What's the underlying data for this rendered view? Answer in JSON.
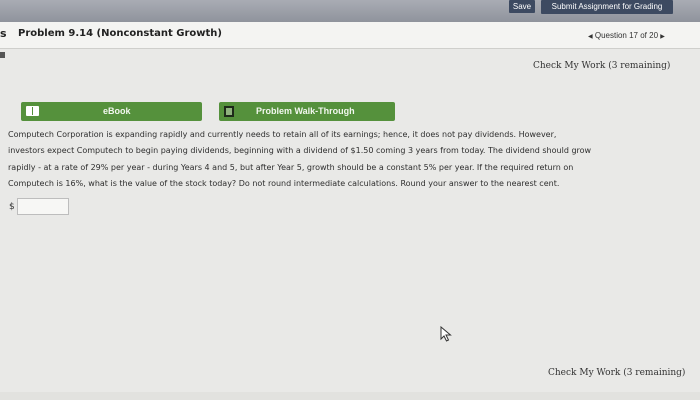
{
  "toolbar": {
    "save_label": "Save",
    "submit_label": "Submit Assignment for Grading"
  },
  "header": {
    "marker": "s",
    "problem_title": "Problem 9.14 (Nonconstant Growth)",
    "question_prev": "◀",
    "question_label": "Question 17 of 20",
    "question_next": "▶"
  },
  "check_work": {
    "top_label": "Check My Work (3 remaining)",
    "bottom_label": "Check My Work (3 remaining)"
  },
  "tools": {
    "ebook_label": "eBook",
    "walkthrough_label": "Problem Walk-Through"
  },
  "problem": {
    "lines": [
      "Computech Corporation is expanding rapidly and currently needs to retain all of its earnings; hence, it does not pay dividends. However,",
      "investors expect Computech to begin paying dividends, beginning with a dividend of $1.50 coming 3 years from today. The dividend should grow",
      "rapidly - at a rate of 29% per year - during Years 4 and 5, but after Year 5, growth should be a constant 5% per year. If the required return on",
      "Computech is 16%, what is the value of the stock today? Do not round intermediate calculations. Round your answer to the nearest cent."
    ],
    "currency_symbol": "$",
    "answer_value": ""
  },
  "icons": {
    "ebook": "book-icon",
    "walkthrough": "walkthrough-icon",
    "cursor": "mouse-pointer-icon"
  },
  "colors": {
    "tool_button_green": "#55913c",
    "toolbar_button_navy": "#3d4a61"
  }
}
